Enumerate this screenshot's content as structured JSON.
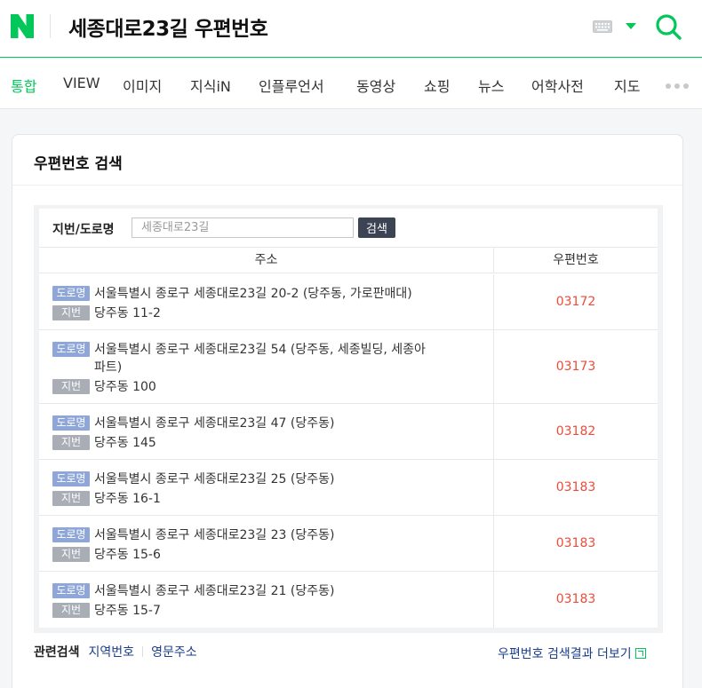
{
  "header": {
    "query": "세종대로23길 우편번호",
    "logo_color": "#03c75a",
    "icons": {
      "keyboard": "keyboard-icon",
      "search": "search-icon",
      "toggle": "chevron-down-icon"
    }
  },
  "tabs": [
    {
      "label": "통합",
      "active": true
    },
    {
      "label": "VIEW",
      "active": false
    },
    {
      "label": "이미지",
      "active": false
    },
    {
      "label": "지식iN",
      "active": false
    },
    {
      "label": "인플루언서",
      "active": false
    },
    {
      "label": "동영상",
      "active": false
    },
    {
      "label": "쇼핑",
      "active": false
    },
    {
      "label": "뉴스",
      "active": false
    },
    {
      "label": "어학사전",
      "active": false
    },
    {
      "label": "지도",
      "active": false
    }
  ],
  "card": {
    "title": "우편번호 검색",
    "search": {
      "label": "지번/도로명",
      "placeholder": "세종대로23길",
      "button": "검색"
    },
    "columns": {
      "address": "주소",
      "zipcode": "우편번호"
    },
    "badges": {
      "road": "도로명",
      "lot": "지번"
    },
    "rows": [
      {
        "road": "서울특별시 종로구 세종대로23길 20-2 (당주동, 가로판매대)",
        "road_cont": "",
        "lot": "당주동 11-2",
        "zip": "03172"
      },
      {
        "road": "서울특별시 종로구 세종대로23길 54 (당주동, 세종빌딩, 세종아",
        "road_cont": "파트)",
        "lot": "당주동 100",
        "zip": "03173"
      },
      {
        "road": "서울특별시 종로구 세종대로23길 47 (당주동)",
        "road_cont": "",
        "lot": "당주동 145",
        "zip": "03182"
      },
      {
        "road": "서울특별시 종로구 세종대로23길 25 (당주동)",
        "road_cont": "",
        "lot": "당주동 16-1",
        "zip": "03183"
      },
      {
        "road": "서울특별시 종로구 세종대로23길 23 (당주동)",
        "road_cont": "",
        "lot": "당주동 15-6",
        "zip": "03183"
      },
      {
        "road": "서울특별시 종로구 세종대로23길 21 (당주동)",
        "road_cont": "",
        "lot": "당주동 15-7",
        "zip": "03183"
      }
    ],
    "related": {
      "label": "관련검색",
      "links": [
        "지역번호",
        "영문주소"
      ]
    },
    "more_link": "우편번호 검색결과 더보기"
  }
}
